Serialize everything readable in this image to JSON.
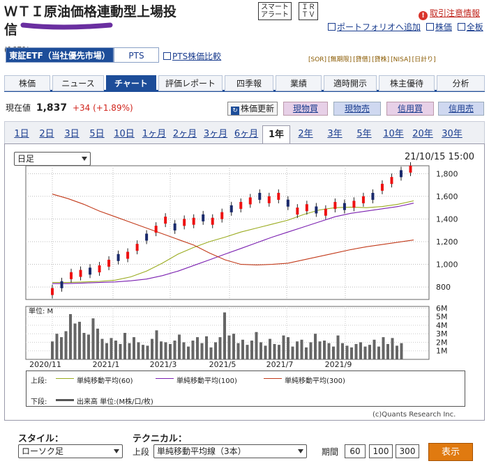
{
  "header": {
    "title": "ＷＴＩ原油価格連動型上場投信",
    "code": "(1671)",
    "btn_smart": [
      "スマート",
      "アラート"
    ],
    "btn_irtv": [
      "ＩＲ",
      "ＴＶ"
    ],
    "caution_icon": "!",
    "caution": "取引注意情報",
    "portfolio": "ポートフォリオへ追加",
    "ticker": "株価",
    "board": "全板",
    "colors": {
      "link": "#1a3d8f",
      "caution": "#d9342b"
    }
  },
  "market_tabs": {
    "active": "東証ETF（当社優先市場）",
    "pts": "PTS",
    "pts_compare": "PTS株価比較"
  },
  "badges": [
    "[SOR]",
    "[無期限]",
    "[貸借]",
    "[貸株]",
    "[NISA]",
    "[日計り]"
  ],
  "nav": [
    "株価",
    "ニュース",
    "チャート",
    "評価レポート",
    "四季報",
    "業績",
    "適時開示",
    "株主優待",
    "分析"
  ],
  "nav_active": 2,
  "price": {
    "label": "現在値",
    "value": "1,837",
    "change": "+34",
    "pct": "(+1.89%)",
    "update": "株価更新",
    "buttons": [
      "現物買",
      "現物売",
      "信用買",
      "信用売"
    ]
  },
  "periods": [
    "1日",
    "2日",
    "3日",
    "5日",
    "10日",
    "1ヶ月",
    "2ヶ月",
    "3ヶ月",
    "6ヶ月",
    "1年",
    "2年",
    "3年",
    "5年",
    "10年",
    "20年",
    "30年"
  ],
  "period_active": 9,
  "chart_controls": {
    "interval": "日足",
    "timestamp": "21/10/15 15:00"
  },
  "chart_data": [
    {
      "type": "line",
      "title": "",
      "yticks": [
        800,
        1000,
        1200,
        1400,
        1600,
        1800
      ],
      "ylim": [
        690,
        1870
      ],
      "xticks": [
        "2020/11",
        "2021/1",
        "2021/3",
        "2021/5",
        "2021/7",
        "2021/9"
      ],
      "series": [
        {
          "name": "単純移動平均(60)",
          "color": "#9aab1f",
          "x": [
            0,
            10,
            20,
            30,
            40,
            50,
            60,
            70,
            80,
            90,
            100,
            110,
            120,
            130,
            140,
            150,
            160,
            170,
            180,
            190,
            200,
            210,
            220,
            230
          ],
          "values": [
            840,
            840,
            845,
            850,
            860,
            890,
            940,
            1010,
            1090,
            1150,
            1200,
            1240,
            1285,
            1320,
            1355,
            1390,
            1440,
            1480,
            1500,
            1505,
            1500,
            1510,
            1530,
            1560
          ]
        },
        {
          "name": "単純移動平均(100)",
          "color": "#7a1fb0",
          "x": [
            0,
            10,
            20,
            30,
            40,
            50,
            60,
            70,
            80,
            90,
            100,
            110,
            120,
            130,
            140,
            150,
            160,
            170,
            180,
            190,
            200,
            210,
            220,
            230
          ],
          "values": [
            830,
            830,
            835,
            840,
            845,
            855,
            870,
            900,
            940,
            990,
            1040,
            1090,
            1140,
            1190,
            1240,
            1285,
            1330,
            1375,
            1420,
            1450,
            1470,
            1490,
            1510,
            1540
          ]
        },
        {
          "name": "単純移動平均(300)",
          "color": "#c23a1a",
          "x": [
            0,
            10,
            20,
            30,
            40,
            50,
            60,
            70,
            80,
            90,
            100,
            110,
            120,
            130,
            140,
            150,
            160,
            170,
            180,
            190,
            200,
            210,
            220,
            230
          ],
          "values": [
            1620,
            1580,
            1530,
            1470,
            1420,
            1370,
            1320,
            1270,
            1220,
            1170,
            1100,
            1040,
            1000,
            995,
            1000,
            1010,
            1040,
            1070,
            1100,
            1130,
            1155,
            1175,
            1195,
            1215
          ]
        },
        {
          "name": "ローソク足",
          "color": "#222",
          "x": [
            0,
            6,
            12,
            18,
            24,
            30,
            36,
            42,
            48,
            54,
            60,
            66,
            72,
            78,
            84,
            90,
            96,
            102,
            108,
            114,
            120,
            126,
            132,
            138,
            144,
            150,
            156,
            162,
            168,
            174,
            180,
            186,
            192,
            198,
            204,
            210,
            216,
            222,
            228
          ],
          "values": [
            760,
            820,
            900,
            920,
            940,
            960,
            1010,
            1060,
            1080,
            1150,
            1240,
            1310,
            1390,
            1330,
            1370,
            1380,
            1410,
            1380,
            1430,
            1490,
            1520,
            1560,
            1600,
            1570,
            1600,
            1540,
            1470,
            1500,
            1480,
            1460,
            1520,
            1510,
            1530,
            1570,
            1600,
            1680,
            1740,
            1800,
            1840
          ]
        }
      ]
    },
    {
      "type": "bar",
      "title": "",
      "ylabel": "単位: M",
      "yticks": [
        "1M",
        "2M",
        "3M",
        "4M",
        "5M",
        "6M"
      ],
      "ylim": [
        0,
        6.2
      ],
      "values": [
        2.1,
        3.0,
        2.6,
        3.3,
        5.3,
        4.2,
        4.4,
        3.1,
        2.9,
        4.8,
        3.6,
        2.4,
        1.9,
        2.5,
        2.2,
        1.8,
        3.1,
        1.9,
        2.6,
        2.0,
        1.7,
        1.6,
        2.4,
        3.4,
        2.1,
        2.0,
        1.8,
        2.2,
        2.9,
        2.0,
        1.5,
        2.2,
        2.6,
        1.9,
        2.7,
        1.4,
        2.0,
        2.6,
        5.5,
        2.8,
        3.0,
        1.9,
        2.3,
        1.7,
        2.2,
        3.2,
        2.0,
        1.6,
        2.4,
        1.8,
        1.7,
        2.8,
        2.6,
        1.5,
        2.1,
        2.3,
        1.4,
        2.0,
        3.0,
        2.1,
        2.2,
        1.9,
        1.5,
        2.8,
        1.9,
        1.6,
        1.4,
        1.8,
        2.0,
        1.5,
        1.7,
        2.3,
        1.5,
        2.6,
        1.8,
        2.5,
        1.6,
        1.9
      ]
    }
  ],
  "legend": {
    "upper_label": "上段:",
    "lower_label": "下段:",
    "ma60": "単純移動平均(60)",
    "ma100": "単純移動平均(100)",
    "ma300": "単純移動平均(300)",
    "volume": "出来高 単位:(M株/口/枚)"
  },
  "credit": "(c)Quants Research Inc.",
  "style_form": {
    "style_label": "スタイル：",
    "style_value": "ローソク足",
    "tech_label": "テクニカル：",
    "upper": "上段",
    "tech_value": "単純移動平均線（3本）",
    "period_label": "期間",
    "p1": "60",
    "p2": "100",
    "p3": "300",
    "submit": "表示"
  }
}
